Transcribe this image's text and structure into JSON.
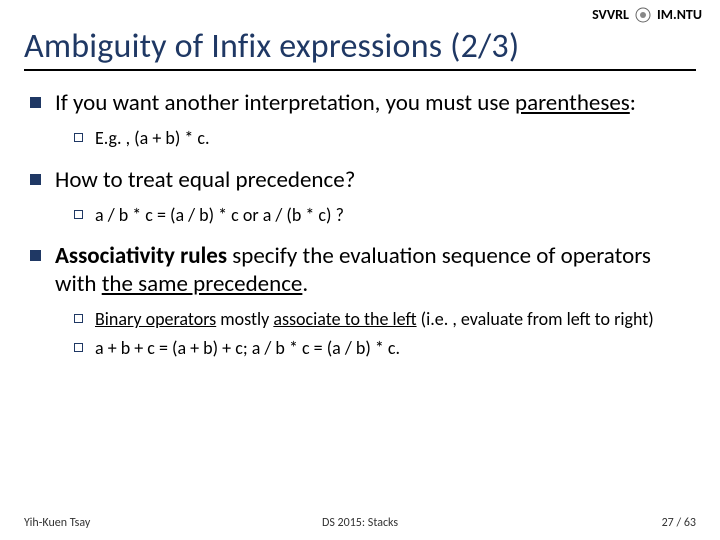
{
  "header": {
    "org_left": "SVVRL",
    "at": "@",
    "org_right": "IM.NTU"
  },
  "title": "Ambiguity of Infix expressions (2/3)",
  "bullets": {
    "b1": {
      "pre": "If you want another interpretation, you must use ",
      "underlined": "parentheses",
      "post": ":",
      "sub1": "E.g. , (a + b) * c."
    },
    "b2": {
      "text": "How to treat equal precedence?",
      "sub1": "a / b * c = (a / b) * c or a / (b * c) ?"
    },
    "b3": {
      "boldA": "Associativity rules",
      "mid": " specify the evaluation sequence of operators with ",
      "underlined": "the same precedence",
      "post": ".",
      "sub1_pre": "",
      "sub1_u1": "Binary operators",
      "sub1_mid": " mostly ",
      "sub1_u2": "associate to the left",
      "sub1_post": " (i.e. , evaluate from left to right)",
      "sub2": "a + b + c = (a + b) + c; a / b * c = (a / b) * c."
    }
  },
  "footer": {
    "left": "Yih-Kuen Tsay",
    "center": "DS 2015: Stacks",
    "page_current": "27",
    "page_sep": " / ",
    "page_total": "63"
  }
}
